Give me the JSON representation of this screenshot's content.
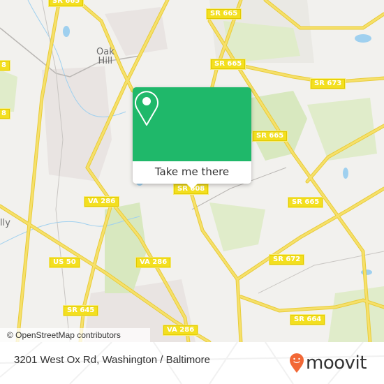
{
  "map": {
    "place_labels": [
      {
        "id": "oak-hill",
        "text": "Oak\nHill"
      },
      {
        "id": "chantilly-partial",
        "text": "lly"
      }
    ],
    "road_shields": [
      {
        "id": "sr665-top-left",
        "text": "SR 665"
      },
      {
        "id": "sr665-top",
        "text": "SR 665"
      },
      {
        "id": "sr665-mid",
        "text": "SR 665"
      },
      {
        "id": "sr673",
        "text": "SR 673"
      },
      {
        "id": "sr665-right",
        "text": "SR 665"
      },
      {
        "id": "sr665-lower",
        "text": "SR 665"
      },
      {
        "id": "sr608",
        "text": "SR 608"
      },
      {
        "id": "va286-top",
        "text": "VA 286"
      },
      {
        "id": "va286-mid",
        "text": "VA 286"
      },
      {
        "id": "va286-bottom",
        "text": "VA 286"
      },
      {
        "id": "us50",
        "text": "US 50"
      },
      {
        "id": "sr672",
        "text": "SR 672"
      },
      {
        "id": "sr645",
        "text": "SR 645"
      },
      {
        "id": "sr664",
        "text": "SR 664"
      },
      {
        "id": "edge-1",
        "text": "8"
      },
      {
        "id": "edge-2",
        "text": "8"
      }
    ],
    "attribution": "© OpenStreetMap contributors",
    "colors": {
      "road": "#f6e06a",
      "road_edge": "#e8cc3a",
      "park": "#d8e8bf",
      "water": "#9fd0ef",
      "urban": "#e9e4e2",
      "background": "#f2f1ee"
    }
  },
  "popup": {
    "button_label": "Take me there",
    "icon": "map-pin-icon",
    "color": "#1fb86a"
  },
  "footer": {
    "address": "3201 West Ox Rd, Washington / Baltimore",
    "brand": "moovit",
    "brand_color": "#f26836"
  }
}
